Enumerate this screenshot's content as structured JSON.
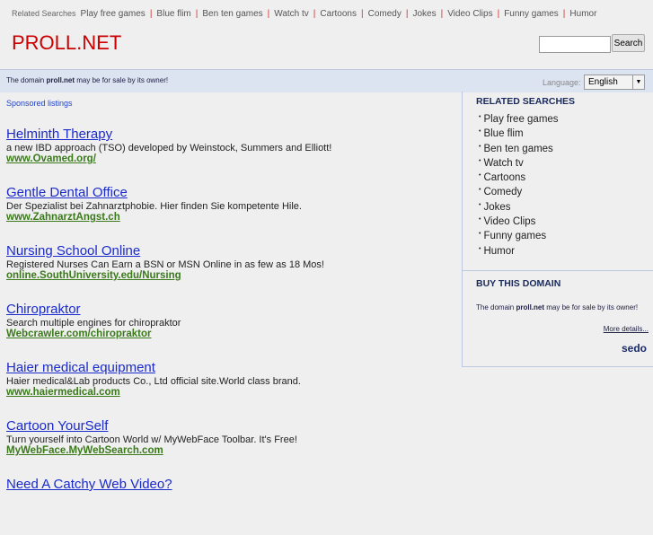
{
  "top_nav": {
    "label": "Related Searches",
    "links": [
      "Play free games",
      "Blue flim",
      "Ben ten games",
      "Watch tv",
      "Cartoons",
      "Comedy",
      "Jokes",
      "Video Clips",
      "Funny games",
      "Humor"
    ]
  },
  "logo": "PROLL.NET",
  "search": {
    "value": "",
    "button": "Search"
  },
  "bar": {
    "msg_pre": "The domain ",
    "domain": "proll.net",
    "msg_post": " may be for sale by its owner!",
    "language_label": "Language:",
    "language": "English"
  },
  "sponsored": "Sponsored listings",
  "ads": [
    {
      "title": "Helminth Therapy",
      "desc": "a new IBD approach (TSO) developed by Weinstock, Summers and Elliott!",
      "url": "www.Ovamed.org/"
    },
    {
      "title": "Gentle Dental Office",
      "desc": "Der Spezialist bei Zahnarztphobie. Hier finden Sie kompetente Hile.",
      "url": "www.ZahnarztAngst.ch"
    },
    {
      "title": "Nursing School Online",
      "desc": "Registered Nurses Can Earn a BSN or MSN Online in as few as 18 Mos!",
      "url": "online.SouthUniversity.edu/Nursing"
    },
    {
      "title": "Chiropraktor",
      "desc": "Search multiple engines for chiropraktor",
      "url": "Webcrawler.com/chiropraktor"
    },
    {
      "title": "Haier medical equipment",
      "desc": "Haier medical&Lab products Co., Ltd official site.World class brand.",
      "url": "www.haiermedical.com"
    },
    {
      "title": "Cartoon YourSelf",
      "desc": "Turn yourself into Cartoon World w/ MyWebFace Toolbar. It's Free!",
      "url": "MyWebFace.MyWebSearch.com"
    },
    {
      "title": "Need A Catchy Web Video?",
      "desc": "",
      "url": ""
    }
  ],
  "sidebar": {
    "related_title": "RELATED SEARCHES",
    "related": [
      "Play free games",
      "Blue flim",
      "Ben ten games",
      "Watch tv",
      "Cartoons",
      "Comedy",
      "Jokes",
      "Video Clips",
      "Funny games",
      "Humor"
    ],
    "buy_title": "BUY THIS DOMAIN",
    "buy_pre": "The domain ",
    "buy_domain": "proll.net",
    "buy_post": " may be for sale by its owner!",
    "more": "More details...",
    "sedo": "sedo"
  }
}
